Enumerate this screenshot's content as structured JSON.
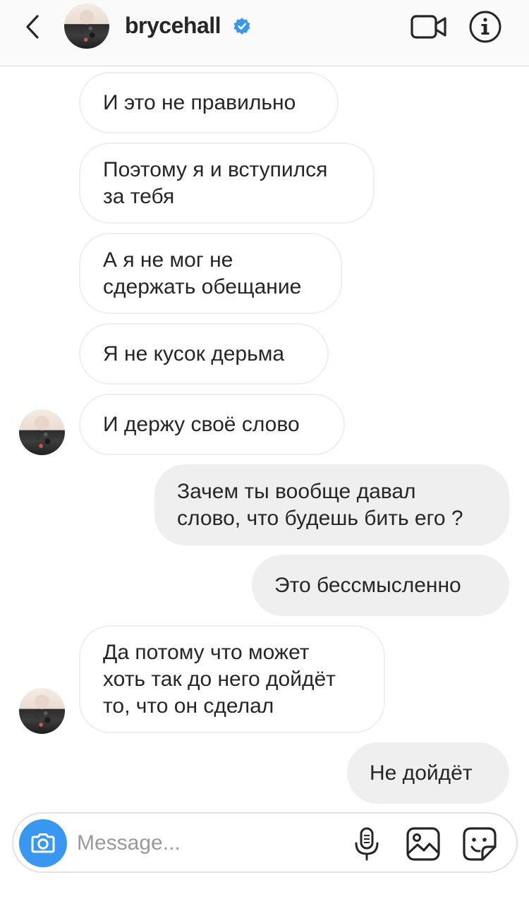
{
  "header": {
    "back_icon": "chevron-left-icon",
    "username": "brycehall",
    "verified_icon": "verified-badge-icon",
    "video_icon": "video-camera-icon",
    "info_icon": "info-icon",
    "verified_color": "#3897f0"
  },
  "messages": [
    {
      "direction": "in",
      "text": "И это не правильно"
    },
    {
      "direction": "in",
      "lines": [
        "Поэтому я и вступился",
        "за тебя"
      ]
    },
    {
      "direction": "in",
      "lines": [
        "А я не мог не",
        "сдержать обещание"
      ]
    },
    {
      "direction": "in",
      "text": "Я не кусок дерьма"
    },
    {
      "direction": "in",
      "text": "И держу своё слово",
      "avatar": true
    },
    {
      "direction": "out",
      "lines": [
        "Зачем ты вообще давал",
        "слово, что будешь бить его ?"
      ]
    },
    {
      "direction": "out",
      "text": "Это бессмысленно"
    },
    {
      "direction": "in",
      "lines": [
        "Да потому что может",
        "хоть так до него дойдёт",
        "то, что он сделал"
      ],
      "avatar": true
    },
    {
      "direction": "out",
      "text": "Не дойдёт"
    }
  ],
  "composer": {
    "placeholder": "Message...",
    "camera_icon": "camera-icon",
    "mic_icon": "microphone-icon",
    "gallery_icon": "gallery-icon",
    "sticker_icon": "sticker-icon",
    "camera_color": "#3897f0"
  },
  "colors": {
    "incoming_bubble": "#ffffff",
    "outgoing_bubble": "#efefef",
    "text": "#262626"
  }
}
